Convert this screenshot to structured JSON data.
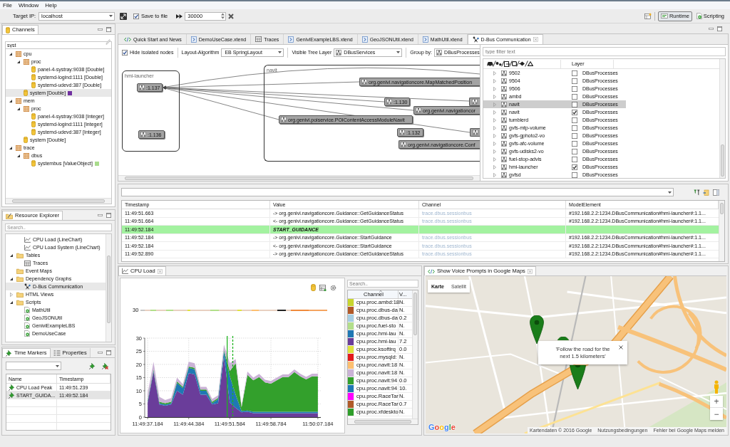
{
  "menu": [
    "File",
    "Window",
    "Help"
  ],
  "toolbar": {
    "target_label": "Target IP:",
    "target_value": "localhost",
    "save_to_file": {
      "label": "Save to file",
      "checked": true
    },
    "buffer_value": "30000",
    "perspectives": [
      {
        "label": "Runtime",
        "kind": "runtime",
        "selected": true
      },
      {
        "label": "Scripting",
        "kind": "scripting",
        "selected": false
      }
    ]
  },
  "channels": {
    "title": "Channels",
    "filter": {
      "value": "syst"
    },
    "tree": [
      {
        "label": "cpu",
        "kind": "group",
        "expanded": true,
        "selected": false,
        "children": [
          {
            "label": "proc",
            "kind": "group",
            "expanded": true,
            "selected": false,
            "children": [
              {
                "label": "panel-4-systray:9038 [Double]",
                "kind": "channel",
                "selected": false
              },
              {
                "label": "systemd-logind:1111 [Double]",
                "kind": "channel",
                "selected": false
              },
              {
                "label": "systemd-udevd:387 [Double]",
                "kind": "channel",
                "selected": false
              }
            ]
          },
          {
            "label": "system [Double]",
            "kind": "channel",
            "selected": true,
            "color": "#7030a0"
          }
        ]
      },
      {
        "label": "mem",
        "kind": "group",
        "expanded": true,
        "selected": false,
        "children": [
          {
            "label": "proc",
            "kind": "group",
            "expanded": true,
            "selected": false,
            "children": [
              {
                "label": "panel-4-systray:9038 [Integer]",
                "kind": "channel",
                "selected": false
              },
              {
                "label": "systemd-logind:1111 [Integer]",
                "kind": "channel",
                "selected": false
              },
              {
                "label": "systemd-udevd:387 [Integer]",
                "kind": "channel",
                "selected": false
              }
            ]
          },
          {
            "label": "system [Double]",
            "kind": "channel",
            "selected": false
          }
        ]
      },
      {
        "label": "trace",
        "kind": "group",
        "expanded": true,
        "selected": false,
        "children": [
          {
            "label": "dbus",
            "kind": "group",
            "expanded": true,
            "selected": false,
            "children": [
              {
                "label": "systembus [ValueObject]",
                "kind": "channel",
                "selected": false,
                "color": "#a9dc8c"
              }
            ]
          }
        ]
      }
    ]
  },
  "resources": {
    "title": "Resource Explorer",
    "search": {
      "placeholder": "Search.."
    },
    "tree": [
      {
        "children": [
          {
            "label": "CPU Load (LineChart)",
            "kind": "chart",
            "selected": false
          },
          {
            "label": "CPU Load System (LineChart)",
            "kind": "chart",
            "selected": false
          }
        ]
      },
      {
        "label": "Tables",
        "kind": "folder",
        "expanded": true,
        "selected": false,
        "children": [
          {
            "label": "Traces",
            "kind": "table",
            "selected": false
          }
        ]
      },
      {
        "label": "Event Maps",
        "kind": "folder",
        "selected": false
      },
      {
        "label": "Dependency Graphs",
        "kind": "folder",
        "expanded": true,
        "selected": false,
        "children": [
          {
            "label": "D-Bus Communication",
            "kind": "graph",
            "selected": true
          }
        ]
      },
      {
        "label": "HTML Views",
        "kind": "folder",
        "expanded": false,
        "selected": false
      },
      {
        "label": "Scripts",
        "kind": "folder",
        "expanded": true,
        "selected": false,
        "children": [
          {
            "label": "MathUtil",
            "kind": "script",
            "selected": false
          },
          {
            "label": "GeoJSONUtil",
            "kind": "script",
            "selected": false
          },
          {
            "label": "GeniviExampleLBS",
            "kind": "script",
            "selected": false
          },
          {
            "label": "DemoUseCase",
            "kind": "script",
            "selected": false
          }
        ]
      }
    ]
  },
  "time_markers": {
    "tabs": [
      {
        "label": "Time Markers",
        "kind": "markers",
        "selected": true
      },
      {
        "label": "Properties",
        "kind": "properties",
        "selected": false
      }
    ],
    "columns": [
      "Name",
      "Timestamp"
    ],
    "rows": [
      {
        "name": "CPU Load Peak",
        "timestamp": "11:49:51.239",
        "selected": false
      },
      {
        "name": "START_GUIDA...",
        "timestamp": "11:49:52.184",
        "selected": true
      }
    ]
  },
  "editor_tabs": [
    {
      "label": "Quick Start and News",
      "kind": "web",
      "selected": false
    },
    {
      "label": "DemoUseCase.xtend",
      "kind": "script",
      "selected": false
    },
    {
      "label": "Traces",
      "kind": "table",
      "selected": false
    },
    {
      "label": "GeniviExampleLBS.xtend",
      "kind": "script",
      "selected": false
    },
    {
      "label": "GeoJSONUtil.xtend",
      "kind": "script",
      "selected": false
    },
    {
      "label": "MathUtil.xtend",
      "kind": "script",
      "selected": false
    },
    {
      "label": "D-Bus Communication",
      "kind": "graph",
      "selected": true
    }
  ],
  "graph": {
    "hide_isolated": {
      "label": "Hide isolated nodes",
      "checked": true
    },
    "layout_label": "Layout-Algorithm",
    "layout_value": "EB SpringLayout",
    "layer_label": "Visible Tree Layer",
    "layer_value": "DBusServices",
    "group_label": "Group by:",
    "group_value": "DBusProcesses",
    "groups": [
      {
        "label": "hmi-launcher",
        "nodes": [
          ":1.137",
          ":1.136"
        ]
      },
      {
        "label": "navit",
        "nodes": [
          "org.genivi.navigationcore.MapMatchedPosition",
          ":1.130",
          "org.genivi.navigationcor",
          "org.genivi.poiservice.POIContentAccessModuleNavit",
          ":1.132",
          "org.genivi.navigationcore.Conf"
        ]
      }
    ]
  },
  "layer_tree": {
    "filter": {
      "placeholder": "type filter text"
    },
    "layer_column": "Layer",
    "rows": [
      {
        "label": "9502",
        "expanded": false,
        "checked": false,
        "selected": false,
        "layer": "DBusProcesses"
      },
      {
        "label": "9504",
        "expanded": false,
        "checked": false,
        "selected": false,
        "layer": "DBusProcesses"
      },
      {
        "label": "9506",
        "expanded": false,
        "checked": false,
        "selected": false,
        "layer": "DBusProcesses"
      },
      {
        "label": "ambd",
        "expanded": false,
        "checked": false,
        "selected": false,
        "layer": "DBusProcesses"
      },
      {
        "label": "navit",
        "expanded": false,
        "checked": false,
        "selected": true,
        "layer": "DBusProcesses"
      },
      {
        "label": "navit",
        "expanded": false,
        "checked": true,
        "selected": false,
        "layer": "DBusProcesses"
      },
      {
        "label": "tumblerd",
        "expanded": false,
        "checked": false,
        "selected": false,
        "layer": "DBusProcesses"
      },
      {
        "label": "gvfs-mtp-volume",
        "expanded": false,
        "checked": false,
        "selected": false,
        "layer": "DBusProcesses"
      },
      {
        "label": "gvfs-gphoto2-vo",
        "expanded": false,
        "checked": false,
        "selected": false,
        "layer": "DBusProcesses"
      },
      {
        "label": "gvfs-afc-volume",
        "expanded": false,
        "checked": false,
        "selected": false,
        "layer": "DBusProcesses"
      },
      {
        "label": "gvfs-udisks2-vo",
        "expanded": false,
        "checked": false,
        "selected": false,
        "layer": "DBusProcesses"
      },
      {
        "label": "fuel-stop-advis",
        "expanded": false,
        "checked": false,
        "selected": false,
        "layer": "DBusProcesses"
      },
      {
        "label": "hmi-launcher",
        "expanded": false,
        "checked": true,
        "selected": false,
        "layer": "DBusProcesses"
      },
      {
        "label": "gvfsd",
        "expanded": false,
        "checked": false,
        "selected": false,
        "layer": "DBusProcesses"
      }
    ]
  },
  "trace": {
    "columns": [
      "Timestamp",
      "Value",
      "Channel",
      "ModelElement"
    ],
    "rows": [
      {
        "kind": "event",
        "timestamp": "11:49:51.663",
        "value": "-> org.genivi.navigationcore.Guidance::GetGuidanceStatus",
        "channel": "trace.dbus.sessionbus",
        "model_element": "#192.168.2.2:1234.DBusCommunication#hmi-launcher#:1.1..."
      },
      {
        "kind": "event",
        "timestamp": "11:49:51.664",
        "value": "<- org.genivi.navigationcore.Guidance::GetGuidanceStatus",
        "channel": "trace.dbus.sessionbus",
        "model_element": "#192.168.2.2:1234.DBusCommunication#hmi-launcher#:1.1..."
      },
      {
        "kind": "marker",
        "timestamp": "11:49:52.184",
        "value": "START_GUIDANCE"
      },
      {
        "kind": "event",
        "timestamp": "11:49:52.184",
        "value": "-> org.genivi.navigationcore.Guidance::StartGuidance",
        "channel": "trace.dbus.sessionbus",
        "model_element": "#192.168.2.2:1234.DBusCommunication#hmi-launcher#:1.1..."
      },
      {
        "kind": "event",
        "timestamp": "11:49:52.184",
        "value": "<- org.genivi.navigationcore.Guidance::StartGuidance",
        "channel": "trace.dbus.sessionbus",
        "model_element": "#192.168.2.2:1234.DBusCommunication#hmi-launcher#:1.1..."
      },
      {
        "kind": "event",
        "timestamp": "11:49:52.890",
        "value": "-> org.genivi.navigationcore.Guidance::GetGuidanceStatus",
        "channel": "trace.dbus.sessionbus",
        "model_element": "#192.168.2.2:1234.DBusCommunication#hmi-launcher#:1.1..."
      }
    ]
  },
  "cpu_load": {
    "title": "CPU Load",
    "overview_label": "30",
    "chart_data": {
      "type": "area",
      "stacked": true,
      "grid": true,
      "categories": [
        "11:49:37.184",
        null,
        null,
        null,
        null,
        null,
        null,
        "11:49:44.384",
        null,
        null,
        null,
        null,
        null,
        null,
        "11:49:51.584",
        null,
        null,
        null,
        null,
        null,
        null,
        "11:49:58.784",
        null,
        null,
        null,
        null,
        null,
        null,
        null,
        "11:50:07.184"
      ],
      "ylim": [
        0,
        30
      ],
      "yticks": [
        0,
        5,
        10,
        15,
        20,
        25,
        30
      ],
      "series": [
        {
          "color": "#6a3d9a",
          "values": [
            5.5,
            17.2,
            4.8,
            4.3,
            4.8,
            10,
            8.5,
            16.7,
            16.2,
            8.5,
            8.5,
            4.8,
            5.3,
            23,
            5.5,
            3.5,
            1.8,
            2,
            1.5,
            1.5,
            1.5,
            1.5,
            1.5,
            1.5,
            1.5,
            1.5,
            1.5,
            1.5,
            1.5,
            1.5
          ]
        },
        {
          "color": "#1f78b4",
          "values": [
            0.5,
            0.5,
            0.5,
            0.5,
            0.5,
            3,
            2.5,
            2,
            2,
            1.5,
            1.5,
            0.5,
            1.5,
            2,
            10,
            5,
            0.5,
            0.5,
            0.5,
            0.5,
            0.5,
            0.5,
            0.5,
            0.5,
            0.5,
            0.5,
            0.5,
            0.5,
            0.5,
            0.5
          ]
        },
        {
          "color": "#33a02c",
          "values": [
            0.5,
            0.5,
            0.5,
            0.5,
            0.5,
            0.5,
            0.5,
            0.5,
            0.5,
            0.5,
            0.5,
            0.5,
            0.5,
            0.5,
            2,
            12,
            1.5,
            13.5,
            12,
            13.2,
            11.2,
            10.7,
            12,
            13.2,
            13.2,
            15.1,
            13.5,
            12.3,
            13.5,
            13.5
          ]
        },
        {
          "color": "#cab2d6",
          "values": [
            2.5,
            2.8,
            1.9,
            1.2,
            1.4,
            1.5,
            1,
            1.8,
            1.8,
            1,
            1,
            1.1,
            1,
            2,
            3,
            1.5,
            0.5,
            1.3,
            1,
            1.2,
            1,
            1,
            1,
            1,
            1,
            1,
            1,
            1,
            1,
            1
          ]
        }
      ]
    },
    "search": {
      "placeholder": "Search.."
    },
    "columns": [
      "Channel",
      "V..."
    ],
    "channels": [
      {
        "name": "cpu.proc.ambd:18",
        "value": "N.",
        "color": "#c8d62e"
      },
      {
        "name": "cpu.proc.dbus-da",
        "value": "N.",
        "color": "#b15928"
      },
      {
        "name": "cpu.proc.dbus-da",
        "value": "0.2",
        "color": "#a6cee3"
      },
      {
        "name": "cpu.proc.fuel-sto",
        "value": "N.",
        "color": "#b2df8a"
      },
      {
        "name": "cpu.proc.hmi-lau",
        "value": "N.",
        "color": "#1f78b4"
      },
      {
        "name": "cpu.proc.hmi-lau",
        "value": "7.2",
        "color": "#6a3d9a"
      },
      {
        "name": "cpu.proc.ksoftirq",
        "value": "0.0",
        "color": "#dfe33c"
      },
      {
        "name": "cpu.proc.mysqld:",
        "value": "N.",
        "color": "#e31a1c"
      },
      {
        "name": "cpu.proc.navit:18",
        "value": "N.",
        "color": "#fdbf6f"
      },
      {
        "name": "cpu.proc.navit:18",
        "value": "N.",
        "color": "#cab2d6"
      },
      {
        "name": "cpu.proc.navit:94",
        "value": "0.0",
        "color": "#33a02c"
      },
      {
        "name": "cpu.proc.navit:94",
        "value": "10.",
        "color": "#1f78b4"
      },
      {
        "name": "cpu.proc.RaceTar",
        "value": "N.",
        "color": "#ff00ff"
      },
      {
        "name": "cpu.proc.RaceTar",
        "value": "0.7",
        "color": "#b05a28"
      },
      {
        "name": "cpu.proc.xfdeskto",
        "value": "N.",
        "color": "#2f9e2a"
      }
    ]
  },
  "map": {
    "title": "Show Voice Prompts in Google Maps",
    "map_types": [
      {
        "label": "Karte",
        "selected": true
      },
      {
        "label": "Satellit",
        "selected": false
      }
    ],
    "info_text": "'Follow the road for the next 1.5 kilometers'",
    "zoom_in": "+",
    "zoom_out": "−",
    "logo": "Google",
    "attribution": [
      "Kartendaten © 2016 Google",
      "Nutzungsbedingungen",
      "Fehler bei Google Maps melden"
    ]
  }
}
